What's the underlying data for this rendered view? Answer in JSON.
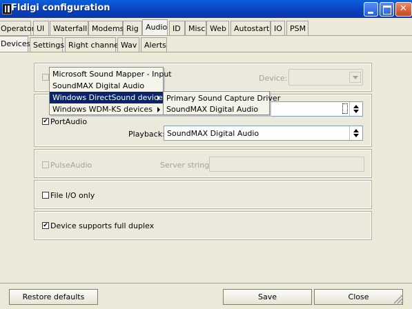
{
  "window": {
    "title": "Fldigi configuration"
  },
  "tabs": [
    "Operator",
    "UI",
    "Waterfall",
    "Modems",
    "Rig",
    "Audio",
    "ID",
    "Misc",
    "Web",
    "Autostart",
    "IO",
    "PSM"
  ],
  "subtabs": [
    "Devices",
    "Settings",
    "Right channel",
    "Wav",
    "Alerts"
  ],
  "audio": {
    "device_label": "Device:",
    "device_value": "",
    "capture_value": "",
    "portaudio_label": "PortAudio",
    "portaudio_checked": true,
    "playback_label": "Playback:",
    "playback_value": "SoundMAX Digital Audio",
    "pulseaudio_label": "PulseAudio",
    "server_label": "Server string:",
    "server_value": "",
    "fileio_label": "File I/O only",
    "fileio_checked": false,
    "duplex_label": "Device supports full duplex",
    "duplex_checked": true
  },
  "menu1": {
    "items": [
      {
        "label": "Microsoft Sound Mapper - Input",
        "submenu": false
      },
      {
        "label": "SoundMAX Digital Audio",
        "submenu": false
      },
      {
        "label": "Windows DirectSound devices",
        "submenu": true,
        "selected": true
      },
      {
        "label": "Windows WDM-KS devices",
        "submenu": true
      }
    ]
  },
  "menu2": {
    "items": [
      "Primary Sound Capture Driver",
      "SoundMAX Digital Audio"
    ]
  },
  "buttons": {
    "restore": "Restore defaults",
    "save": "Save",
    "close": "Close"
  },
  "icons": [
    "fldigi-app-icon",
    "minimize-icon",
    "maximize-icon",
    "close-icon",
    "dropdown-arrow-icon",
    "spinner-arrows-icon",
    "submenu-arrow-icon",
    "resize-grip-icon"
  ]
}
